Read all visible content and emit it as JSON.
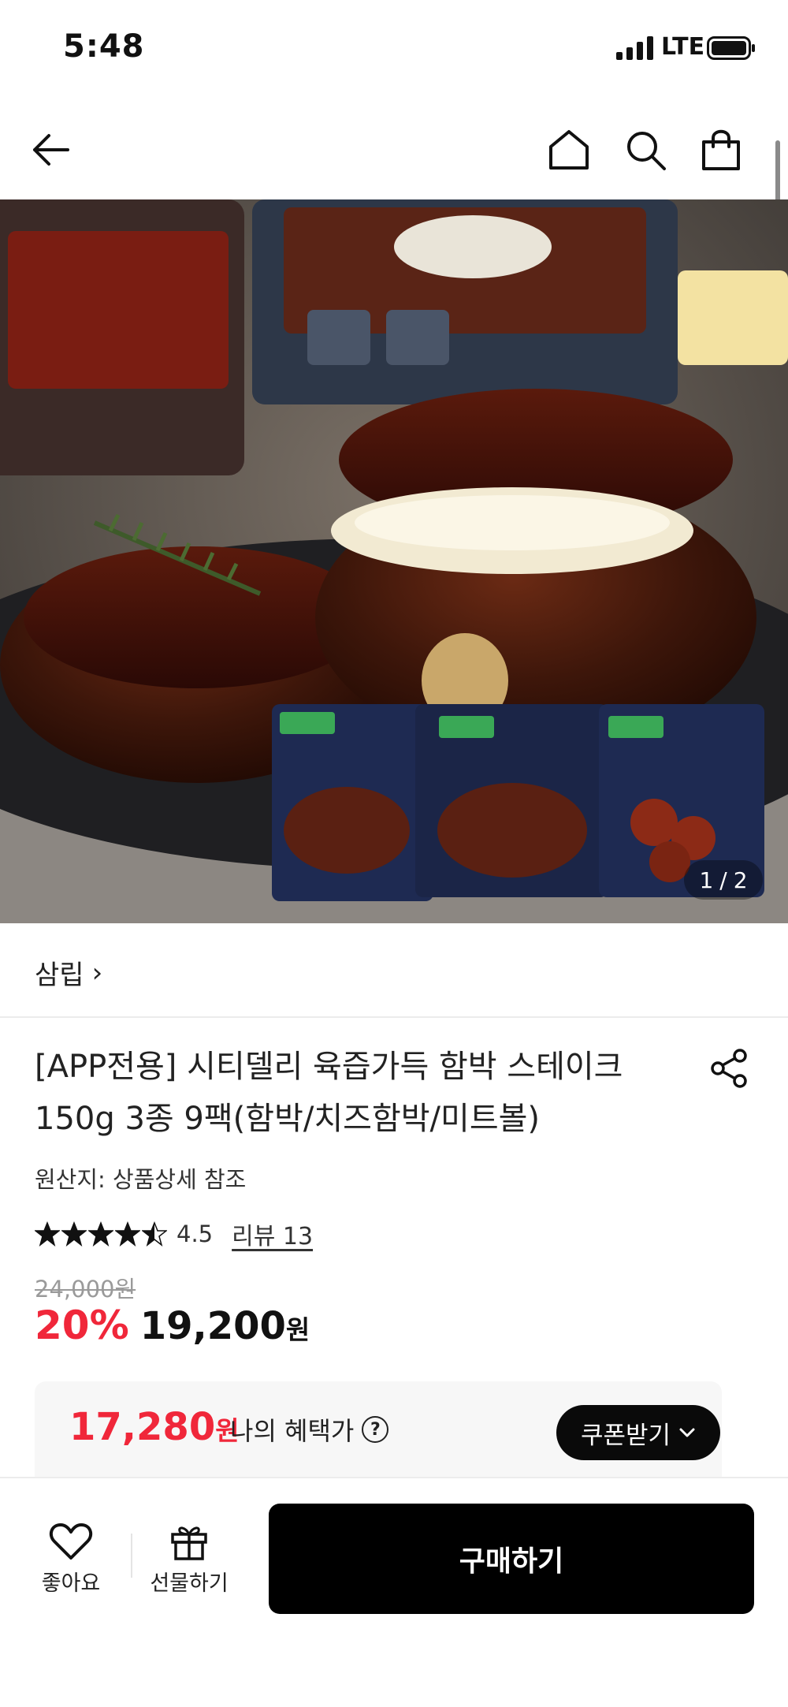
{
  "status_bar": {
    "time": "5:48",
    "network": "LTE"
  },
  "nav": {
    "icons": [
      "back-arrow-icon",
      "home-icon",
      "search-icon",
      "shopping-bag-icon"
    ]
  },
  "hero": {
    "pager_current": "1",
    "pager_separator": "/",
    "pager_total": "2"
  },
  "brand": {
    "name": "삼립",
    "chevron": "›"
  },
  "product": {
    "title": "[APP전용] 시티델리 육즙가득 함박 스테이크 150g 3종 9팩(함박/치즈함박/미트볼)",
    "origin": "원산지: 상품상세 참조",
    "rating": "4.5",
    "rating_stars": 4.5,
    "review_label": "리뷰 13",
    "original_price": "24,000원",
    "discount": "20%",
    "sale_price": "19,200",
    "sale_unit": "원"
  },
  "benefit": {
    "amount": "17,280",
    "unit": "원",
    "label": "나의 혜택가",
    "help_icon": "?",
    "coupon_button": "쿠폰받기"
  },
  "bottom_bar": {
    "like_label": "좋아요",
    "gift_label": "선물하기",
    "buy_label": "구매하기"
  },
  "colors": {
    "accent_red": "#f0273a",
    "primary_black": "#000000"
  }
}
